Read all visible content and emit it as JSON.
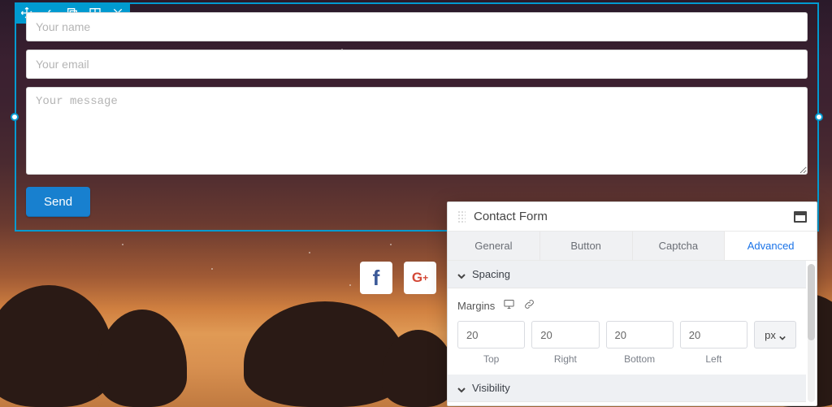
{
  "form": {
    "name_placeholder": "Your name",
    "email_placeholder": "Your email",
    "message_placeholder": "Your message",
    "send_label": "Send"
  },
  "social": {
    "facebook_glyph": "f",
    "gplus_glyph": "G",
    "gplus_sup": "+"
  },
  "panel": {
    "title": "Contact Form",
    "tabs": {
      "general": "General",
      "button": "Button",
      "captcha": "Captcha",
      "advanced": "Advanced",
      "active": "advanced"
    },
    "sections": {
      "spacing": {
        "label": "Spacing",
        "margins_label": "Margins",
        "margins": {
          "top": "20",
          "right": "20",
          "bottom": "20",
          "left": "20"
        },
        "unit": "px",
        "side_names": {
          "top": "Top",
          "right": "Right",
          "bottom": "Bottom",
          "left": "Left"
        }
      },
      "visibility": {
        "label": "Visibility"
      }
    }
  }
}
